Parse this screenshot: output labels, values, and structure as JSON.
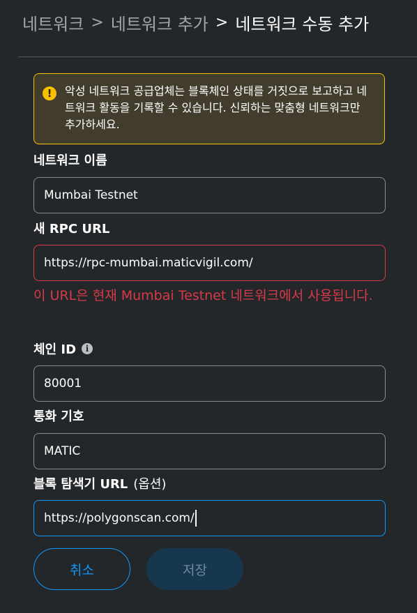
{
  "breadcrumb": {
    "items": [
      "네트워크",
      "네트워크 추가",
      "네트워크 수동 추가"
    ],
    "separator": ">"
  },
  "warning": {
    "icon": "warning-icon",
    "text": "악성 네트워크 공급업체는 블록체인 상태를 거짓으로 보고하고 네트워크 활동을 기록할 수 있습니다. 신뢰하는 맞춤형 네트워크만 추가하세요."
  },
  "form": {
    "network_name": {
      "label": "네트워크 이름",
      "value": "Mumbai Testnet"
    },
    "rpc_url": {
      "label": "새 RPC URL",
      "value": "https://rpc-mumbai.maticvigil.com/",
      "error": "이 URL은 현재 Mumbai Testnet 네트워크에서 사용됩니다."
    },
    "chain_id": {
      "label": "체인 ID",
      "value": "80001",
      "info_icon": "info-icon"
    },
    "currency_symbol": {
      "label": "통화 기호",
      "value": "MATIC"
    },
    "block_explorer": {
      "label": "블록 탐색기 URL",
      "optional": "(옵션)",
      "value": "https://polygonscan.com/"
    }
  },
  "buttons": {
    "cancel": "취소",
    "save": "저장"
  },
  "colors": {
    "background": "#24272a",
    "primary": "#1098fc",
    "error": "#d73a49",
    "warning": "#f8c000"
  }
}
